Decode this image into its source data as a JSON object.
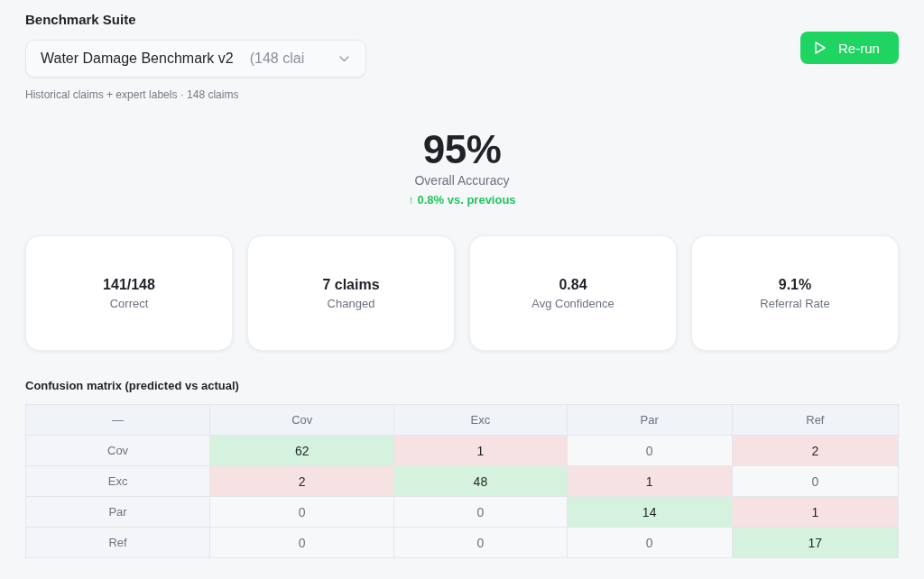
{
  "header": {
    "title": "Benchmark Suite"
  },
  "suite_select": {
    "value": "Water Damage Benchmark v2",
    "detail": "(148 clai"
  },
  "description": "Historical claims + expert labels · 148 claims",
  "rerun_button": {
    "label": "Re-run"
  },
  "accuracy": {
    "value": "95%",
    "label": "Overall Accuracy",
    "delta": "↑ 0.8% vs. previous"
  },
  "stats": [
    {
      "value": "141/148",
      "label": "Correct"
    },
    {
      "value": "7 claims",
      "label": "Changed"
    },
    {
      "value": "0.84",
      "label": "Avg Confidence"
    },
    {
      "value": "9.1%",
      "label": "Referral Rate"
    }
  ],
  "confusion_matrix": {
    "title": "Confusion matrix (predicted vs actual)",
    "columns": [
      "—",
      "Cov",
      "Exc",
      "Par",
      "Ref"
    ],
    "rows": [
      {
        "cells": [
          {
            "value": "Cov",
            "kind": "label"
          },
          {
            "value": "62",
            "kind": "correct"
          },
          {
            "value": "1",
            "kind": "error"
          },
          {
            "value": "0",
            "kind": "none"
          },
          {
            "value": "2",
            "kind": "error"
          }
        ]
      },
      {
        "cells": [
          {
            "value": "Exc",
            "kind": "label"
          },
          {
            "value": "2",
            "kind": "error"
          },
          {
            "value": "48",
            "kind": "correct"
          },
          {
            "value": "1",
            "kind": "error"
          },
          {
            "value": "0",
            "kind": "none"
          }
        ]
      },
      {
        "cells": [
          {
            "value": "Par",
            "kind": "label"
          },
          {
            "value": "0",
            "kind": "none"
          },
          {
            "value": "0",
            "kind": "none"
          },
          {
            "value": "14",
            "kind": "correct"
          },
          {
            "value": "1",
            "kind": "error"
          }
        ]
      },
      {
        "cells": [
          {
            "value": "Ref",
            "kind": "label"
          },
          {
            "value": "0",
            "kind": "none"
          },
          {
            "value": "0",
            "kind": "none"
          },
          {
            "value": "0",
            "kind": "none"
          },
          {
            "value": "17",
            "kind": "correct"
          }
        ]
      }
    ]
  }
}
